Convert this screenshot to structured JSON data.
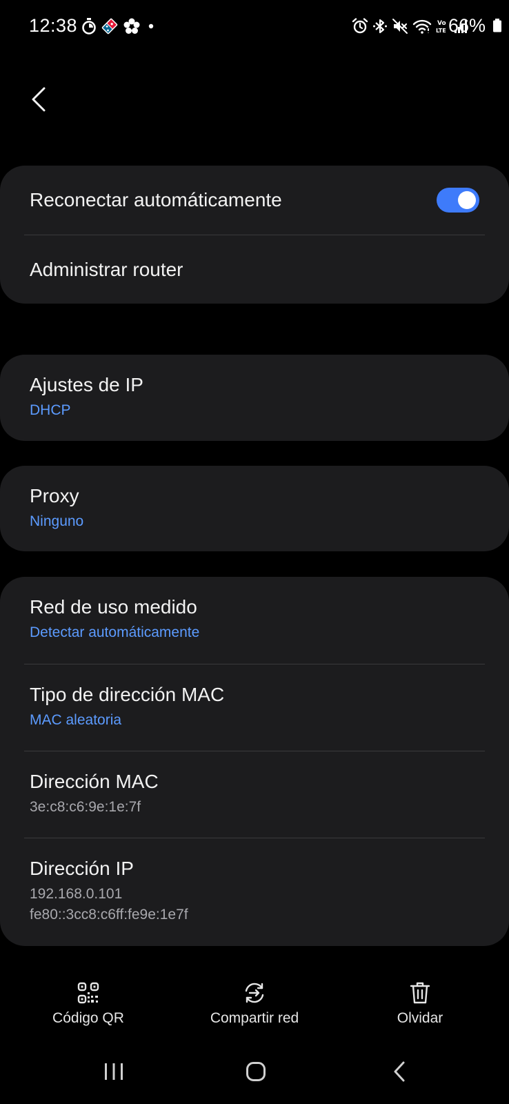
{
  "status_bar": {
    "time": "12:38",
    "battery": "66%",
    "left_icons": [
      "timer-icon",
      "dominos-app-icon",
      "flower-app-icon",
      "dot-icon"
    ],
    "right_icons": [
      "alarm-icon",
      "bluetooth-icon",
      "mute-icon",
      "wifi-icon",
      "volte-icon",
      "signal-icon",
      "battery-icon"
    ]
  },
  "colors": {
    "background": "#000000",
    "card": "#1c1c1e",
    "accent": "#3e7bfa",
    "link": "#5c9bff",
    "secondary_text": "#a8a8ad"
  },
  "card_general": {
    "auto_reconnect": {
      "label": "Reconectar automáticamente",
      "enabled": true
    },
    "manage_router": {
      "label": "Administrar router"
    }
  },
  "card_ip": {
    "title": "Ajustes de IP",
    "value": "DHCP"
  },
  "card_proxy": {
    "title": "Proxy",
    "value": "Ninguno"
  },
  "card_details": {
    "metered": {
      "title": "Red de uso medido",
      "value": "Detectar automáticamente"
    },
    "mac_type": {
      "title": "Tipo de dirección MAC",
      "value": "MAC aleatoria"
    },
    "mac_address": {
      "title": "Dirección MAC",
      "value": "3e:c8:c6:9e:1e:7f"
    },
    "ip_address": {
      "title": "Dirección IP",
      "ipv4": "192.168.0.101",
      "ipv6": "fe80::3cc8:c6ff:fe9e:1e7f"
    }
  },
  "bottom_actions": {
    "qr": {
      "label": "Código QR",
      "icon": "qr-code-icon"
    },
    "share": {
      "label": "Compartir red",
      "icon": "share-network-icon"
    },
    "forget": {
      "label": "Olvidar",
      "icon": "trash-icon"
    }
  },
  "nav_bar": [
    "recent-apps-icon",
    "home-icon",
    "back-icon"
  ]
}
